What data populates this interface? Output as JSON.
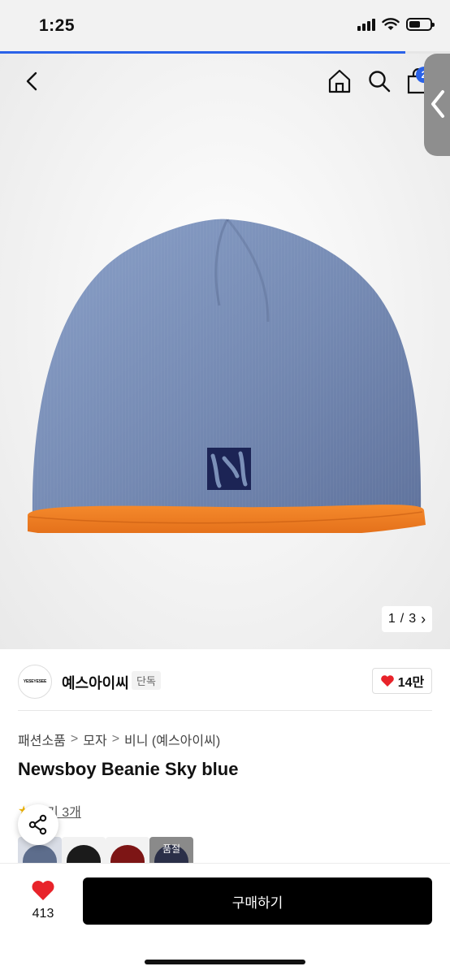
{
  "status_bar": {
    "time": "1:25",
    "icons": [
      "signal-icon",
      "wifi-icon",
      "battery-icon"
    ]
  },
  "page_load_progress": 0.9,
  "header": {
    "cart_count": "2",
    "icons": [
      "back-icon",
      "home-icon",
      "search-icon",
      "cart-icon"
    ]
  },
  "gallery": {
    "counter_current": "1",
    "counter_sep": "/",
    "counter_total": "3",
    "counter_chevron": "›"
  },
  "brand": {
    "logo_text": "YESEYESEE",
    "name": "예스아이씨",
    "tag": "단독",
    "likes": "14만"
  },
  "product": {
    "breadcrumb": [
      "패션소품",
      "모자",
      "비니 (예스아이씨)"
    ],
    "breadcrumb_sep": ">",
    "title": "Newsboy Beanie Sky blue",
    "review_link": "후기 3개"
  },
  "swatches": [
    {
      "color": "#5d6d8c"
    },
    {
      "color": "#1b1b1b"
    },
    {
      "color": "#7d1515"
    },
    {
      "color": "#2a2f48",
      "label": "품절"
    }
  ],
  "bottom_bar": {
    "wish_count": "413",
    "buy_label": "구매하기"
  },
  "colors": {
    "accent": "#2a62e8",
    "beanie_body": "#7b90b8",
    "beanie_band": "#f07b22",
    "logo_navy": "#1c2455",
    "heart": "#e8232a"
  }
}
